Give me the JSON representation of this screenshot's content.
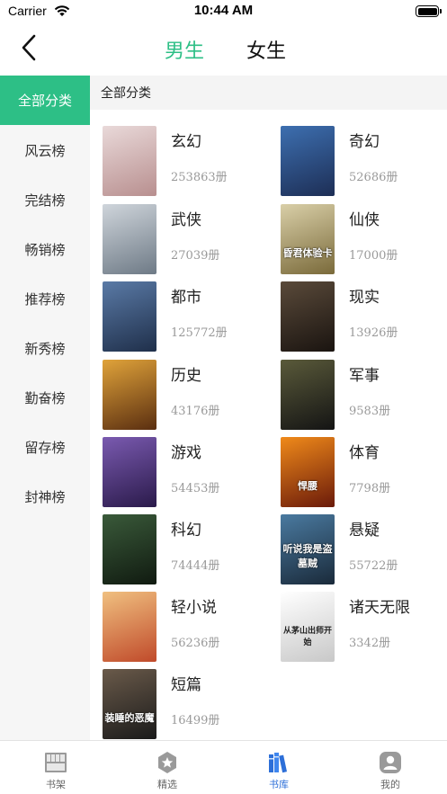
{
  "status_bar": {
    "carrier": "Carrier",
    "time": "10:44 AM"
  },
  "nav": {
    "back_icon": "chevron-left-icon",
    "tabs": [
      {
        "label": "男生",
        "active": true
      },
      {
        "label": "女生",
        "active": false
      }
    ],
    "accent": "#2dbf86"
  },
  "sidebar": {
    "items": [
      {
        "label": "全部分类",
        "active": true
      },
      {
        "label": "风云榜"
      },
      {
        "label": "完结榜"
      },
      {
        "label": "畅销榜"
      },
      {
        "label": "推荐榜"
      },
      {
        "label": "新秀榜"
      },
      {
        "label": "勤奋榜"
      },
      {
        "label": "留存榜"
      },
      {
        "label": "封神榜"
      }
    ]
  },
  "section": {
    "title": "全部分类"
  },
  "categories": [
    {
      "name": "玄幻",
      "count": "253863册",
      "cover_text": "",
      "cover": [
        "#e9d9d9",
        "#b88f8f"
      ]
    },
    {
      "name": "奇幻",
      "count": "52686册",
      "cover_text": "",
      "cover": [
        "#3d6fb0",
        "#1d2e55"
      ]
    },
    {
      "name": "武侠",
      "count": "27039册",
      "cover_text": "",
      "cover": [
        "#cfd5db",
        "#6e7a86"
      ]
    },
    {
      "name": "仙侠",
      "count": "17000册",
      "cover_text": "昏君体验卡",
      "cover": [
        "#d9cfa8",
        "#7a6a3a"
      ]
    },
    {
      "name": "都市",
      "count": "125772册",
      "cover_text": "",
      "cover": [
        "#5a7aa6",
        "#1f2f4a"
      ]
    },
    {
      "name": "现实",
      "count": "13926册",
      "cover_text": "",
      "cover": [
        "#5a4a3a",
        "#1a1410"
      ]
    },
    {
      "name": "历史",
      "count": "43176册",
      "cover_text": "",
      "cover": [
        "#e0a33a",
        "#5a2e10"
      ]
    },
    {
      "name": "军事",
      "count": "9583册",
      "cover_text": "",
      "cover": [
        "#5a5a3a",
        "#141414"
      ]
    },
    {
      "name": "游戏",
      "count": "54453册",
      "cover_text": "",
      "cover": [
        "#7a5ab0",
        "#2a1a4a"
      ]
    },
    {
      "name": "体育",
      "count": "7798册",
      "cover_text": "悍腰",
      "cover": [
        "#f08a1a",
        "#6a1a0a"
      ]
    },
    {
      "name": "科幻",
      "count": "74444册",
      "cover_text": "",
      "cover": [
        "#3a5a3a",
        "#101a10"
      ]
    },
    {
      "name": "悬疑",
      "count": "55722册",
      "cover_text": "听说我是盗墓贼",
      "cover": [
        "#4a7aa0",
        "#1a2a3a"
      ]
    },
    {
      "name": "轻小说",
      "count": "56236册",
      "cover_text": "",
      "cover": [
        "#f0c080",
        "#c04a2a"
      ]
    },
    {
      "name": "诸天无限",
      "count": "3342册",
      "cover_text": "从茅山出师开始",
      "cover": [
        "#ffffff",
        "#c8c8c8"
      ]
    },
    {
      "name": "短篇",
      "count": "16499册",
      "cover_text": "装睡的恶魔",
      "cover": [
        "#6a5a4a",
        "#1a1a1a"
      ]
    }
  ],
  "tab_bar": {
    "items": [
      {
        "label": "书架",
        "icon": "bookshelf-icon",
        "active": false
      },
      {
        "label": "精选",
        "icon": "star-badge-icon",
        "active": false
      },
      {
        "label": "书库",
        "icon": "library-books-icon",
        "active": true
      },
      {
        "label": "我的",
        "icon": "profile-icon",
        "active": false
      }
    ],
    "active_color": "#2d6fd8"
  }
}
